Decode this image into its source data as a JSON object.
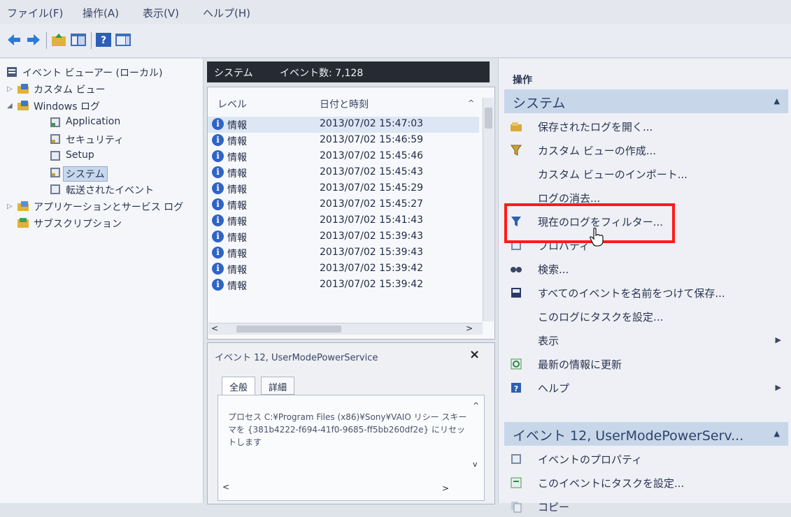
{
  "menubar": {
    "file": "ファイル(F)",
    "action": "操作(A)",
    "view": "表示(V)",
    "help": "ヘルプ(H)"
  },
  "tree": {
    "root": "イベント ビューアー (ローカル)",
    "custom_views": "カスタム ビュー",
    "windows_logs": "Windows ログ",
    "application": "Application",
    "security": "セキュリティ",
    "setup": "Setup",
    "system": "システム",
    "forwarded": "転送されたイベント",
    "app_service_logs": "アプリケーションとサービス ログ",
    "subscriptions": "サブスクリプション"
  },
  "center": {
    "log_name": "システム",
    "event_count": "イベント数: 7,128",
    "col_level": "レベル",
    "col_datetime": "日付と時刻",
    "rows": [
      {
        "level": "情報",
        "datetime": "2013/07/02 15:47:03"
      },
      {
        "level": "情報",
        "datetime": "2013/07/02 15:46:59"
      },
      {
        "level": "情報",
        "datetime": "2013/07/02 15:45:46"
      },
      {
        "level": "情報",
        "datetime": "2013/07/02 15:45:43"
      },
      {
        "level": "情報",
        "datetime": "2013/07/02 15:45:29"
      },
      {
        "level": "情報",
        "datetime": "2013/07/02 15:45:27"
      },
      {
        "level": "情報",
        "datetime": "2013/07/02 15:41:43"
      },
      {
        "level": "情報",
        "datetime": "2013/07/02 15:39:43"
      },
      {
        "level": "情報",
        "datetime": "2013/07/02 15:39:43"
      },
      {
        "level": "情報",
        "datetime": "2013/07/02 15:39:42"
      },
      {
        "level": "情報",
        "datetime": "2013/07/02 15:39:42"
      }
    ]
  },
  "detail": {
    "title": "イベント 12, UserModePowerService",
    "close": "×",
    "tab_general": "全般",
    "tab_details": "詳細",
    "text": "プロセス C:¥Program Files (x86)¥Sony¥VAIO リシー スキーマを {381b4222-f694-41f0-9685-ff5bb260df2e} にリセットします"
  },
  "right": {
    "title": "操作",
    "section1": "システム",
    "actions": [
      "保存されたログを開く...",
      "カスタム ビューの作成...",
      "カスタム ビューのインポート...",
      "ログの消去...",
      "現在のログをフィルター...",
      "プロパティ",
      "検索...",
      "すべてのイベントを名前をつけて保存...",
      "このログにタスクを設定...",
      "表示",
      "最新の情報に更新",
      "ヘルプ"
    ],
    "section2": "イベント 12, UserModePowerServ...",
    "event_actions": [
      "イベントのプロパティ",
      "このイベントにタスクを設定...",
      "コピー"
    ]
  },
  "colors": {
    "highlight": "#ff1a1a",
    "section_header": "#c8d6ea",
    "info_icon": "#2f64c4"
  }
}
